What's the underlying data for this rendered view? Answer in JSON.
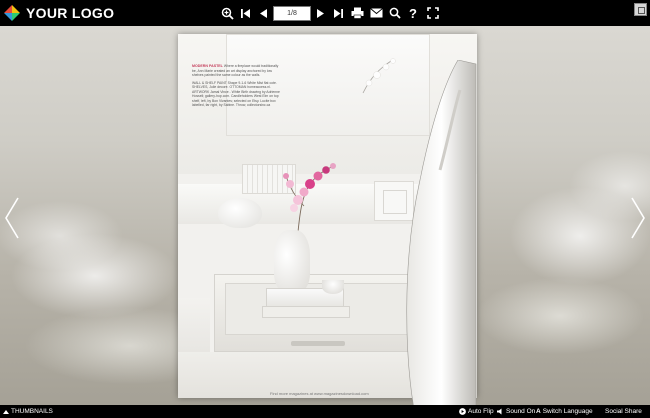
{
  "topbar": {
    "logo_text": "YOUR LOGO",
    "page_indicator": "1/8",
    "icons": [
      "zoom-in-icon",
      "first-page-icon",
      "prev-page-icon",
      "next-page-icon",
      "last-page-icon",
      "print-icon",
      "email-icon",
      "search-icon",
      "help-icon",
      "fullscreen-icon"
    ]
  },
  "magazine": {
    "article_heading": "MODERN PASTEL",
    "article_body": "Where a fireplace would traditionally be, Ann Marie created an art display anchored by low shelves painted the same colour as the walls.",
    "article_caption": "WALL & SHELF PAINT Shape 9-1-6 White Mist flat cote. SHELVES, Julie decore. OTTOMAN homeaccess.nl. ARTWORK Jamal Vince - White Birth drawing by Adrienne Hossell; gallery-hop.com. Candleholders West Elm on top shelf, left, by Bon Vivantes; selected on Etsy. Lucite box labelled, far right, by Sabine. Throw, collectorsinc.ca",
    "footer_credit": "Find more magazines at www.magazinesdownload.com"
  },
  "bottombar": {
    "thumbnails_label": "THUMBNAILS",
    "autoflip_label": "Auto Flip",
    "sound_label": "Sound On",
    "language_label": "Switch Language",
    "share_label": "Social Share"
  },
  "colors": {
    "bar": "#000000",
    "accent_pink": "#c43e5b"
  }
}
